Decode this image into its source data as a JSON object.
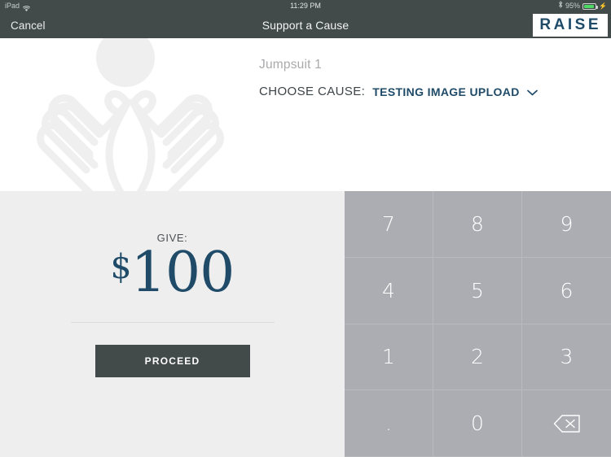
{
  "status_bar": {
    "device": "iPad",
    "wifi_icon": "wifi-icon",
    "time": "11:29 PM",
    "bluetooth_icon": "bluetooth-icon",
    "battery_percent": "95%",
    "battery_level": 95,
    "battery_color": "#4cd964",
    "charging_icon": "lightning-bolt-icon"
  },
  "navbar": {
    "cancel_label": "Cancel",
    "title": "Support a Cause",
    "logo_text": "RAISE",
    "logo_color": "#1f4b68",
    "background_color": "#434a4a"
  },
  "hero": {
    "placeholder_icon": "hands-heart-placeholder-icon",
    "item_name": "Jumpsuit 1",
    "choose_cause_label": "CHOOSE CAUSE:",
    "selected_cause": "TESTING IMAGE UPLOAD",
    "dropdown_icon": "chevron-down-icon"
  },
  "give_panel": {
    "give_label": "GIVE:",
    "currency_symbol": "$",
    "amount": "100",
    "amount_color": "#1f4b68",
    "proceed_label": "PROCEED",
    "proceed_color": "#434a4a",
    "background_color": "#eeeeee"
  },
  "keypad": {
    "background_color": "#abadb2",
    "keys": [
      {
        "label": "7",
        "name": "key-7"
      },
      {
        "label": "8",
        "name": "key-8"
      },
      {
        "label": "9",
        "name": "key-9"
      },
      {
        "label": "4",
        "name": "key-4"
      },
      {
        "label": "5",
        "name": "key-5"
      },
      {
        "label": "6",
        "name": "key-6"
      },
      {
        "label": "1",
        "name": "key-1"
      },
      {
        "label": "2",
        "name": "key-2"
      },
      {
        "label": "3",
        "name": "key-3"
      },
      {
        "label": ".",
        "name": "key-decimal"
      },
      {
        "label": "0",
        "name": "key-0"
      },
      {
        "label": "",
        "name": "key-backspace",
        "icon": "backspace-icon"
      }
    ]
  }
}
